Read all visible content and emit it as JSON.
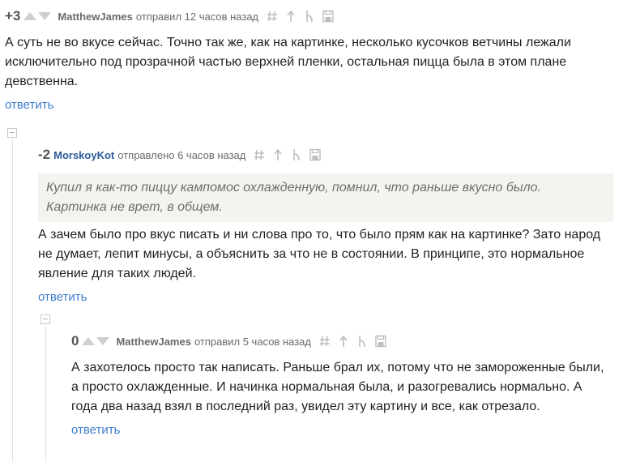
{
  "comments": [
    {
      "rating": "+3",
      "author": "MatthewJames",
      "meta": "отправил 12 часов назад",
      "text": "А суть не во вкусе сейчас. Точно так же, как на картинке, несколько кусочков ветчины лежали исключительно под прозрачной частью верхней пленки, остальная пицца была в этом плане девственна.",
      "reply": "ответить"
    },
    {
      "rating": "-2",
      "author": "MorskoyKot",
      "meta": "отправлено 6 часов назад",
      "quote": "Купил я как-то пиццу кампомос охлажденную, помнил, что раньше вкусно было. Картинка не врет, в общем.",
      "text": "А зачем было про вкус писать и ни слова про то, что было прям как на картинке? Зато народ не думает, лепит минусы, а объяснить за что не в состоянии. В принципе, это нормальное явление для таких людей.",
      "reply": "ответить"
    },
    {
      "rating": "0",
      "author": "MatthewJames",
      "meta": "отправил 5 часов назад",
      "text": "А захотелось просто так написать. Раньше брал их, потому что не замороженные были, а просто охлажденные. И начинка нормальная была, и разогревались нормально. А года два назад взял в последний раз, увидел эту картину и все, как отрезало.",
      "reply": "ответить"
    }
  ],
  "icons": {
    "link": "hash-icon",
    "parent": "arrow-up-icon",
    "thread": "branch-icon",
    "save": "save-icon"
  },
  "colors": {
    "author_highlight": "#2a5a9a",
    "reply_link": "#3d7ccf",
    "quote_bg": "#f3f3ef"
  }
}
